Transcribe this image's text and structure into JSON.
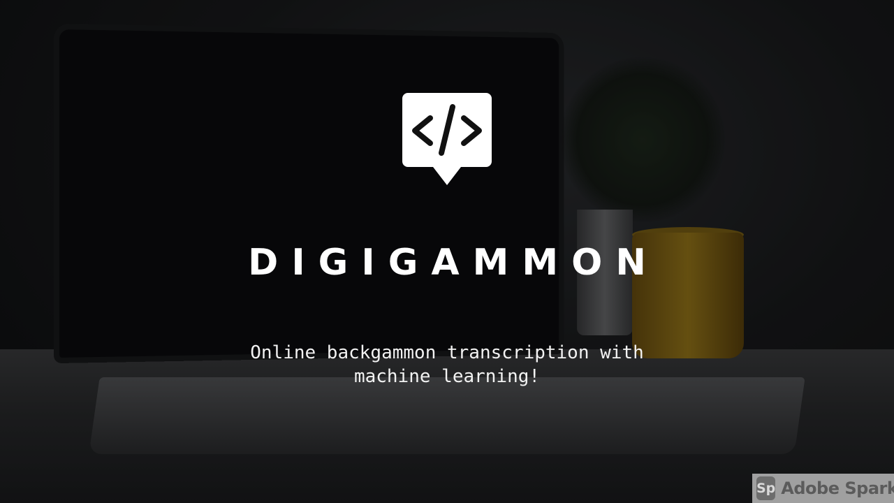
{
  "hero": {
    "logo_icon": "code-brackets-speech-bubble-icon",
    "title": "DIGIGAMMON",
    "subtitle_line1": "Online backgammon transcription with",
    "subtitle_line2": "machine learning!"
  },
  "watermark": {
    "icon_text": "Sp",
    "label": "Adobe Spark"
  }
}
